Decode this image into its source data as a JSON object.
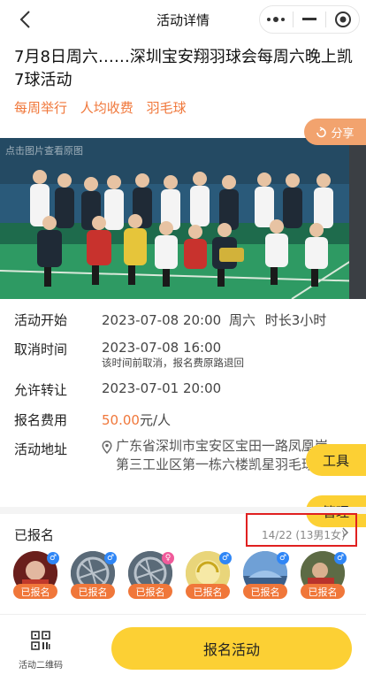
{
  "header": {
    "title": "活动详情"
  },
  "activity": {
    "title": "7月8日周六……深圳宝安翔羽球会每周六晚上凯7球活动",
    "tags": [
      "每周举行",
      "人均收费",
      "羽毛球"
    ],
    "photo_hint": "点击图片查看原图",
    "share_label": "分享"
  },
  "info": {
    "start": {
      "label": "活动开始",
      "date": "2023-07-08 20:00",
      "weekday": "周六",
      "duration": "时长3小时"
    },
    "cancel": {
      "label": "取消时间",
      "date": "2023-07-08 16:00",
      "note": "该时间前取消，报名费原路退回"
    },
    "transfer": {
      "label": "允许转让",
      "date": "2023-07-01 20:00"
    },
    "fee": {
      "label": "报名费用",
      "amount": "50.00",
      "unit": "元/人"
    },
    "address": {
      "label": "活动地址",
      "text": "广东省深圳市宝安区宝田一路凤凰岗第三工业区第一栋六楼凯星羽毛球馆"
    }
  },
  "floating": {
    "tools": "工具",
    "manage": "管理"
  },
  "registered": {
    "label": "已报名",
    "count": "14/22 (13男1女)",
    "members": [
      {
        "tag": "已报名",
        "gender": "♂"
      },
      {
        "tag": "已报名",
        "gender": "♂"
      },
      {
        "tag": "已报名",
        "gender": "♀"
      },
      {
        "tag": "已报名",
        "gender": "♂"
      },
      {
        "tag": "已报名",
        "gender": "♂"
      },
      {
        "tag": "已报名",
        "gender": "♂"
      }
    ]
  },
  "bottom": {
    "qr_label": "活动二维码",
    "signup_label": "报名活动"
  },
  "colors": {
    "accent": "#f0773a",
    "yellow": "#fcd034",
    "male": "#2f86f6",
    "female": "#f05a9a"
  }
}
